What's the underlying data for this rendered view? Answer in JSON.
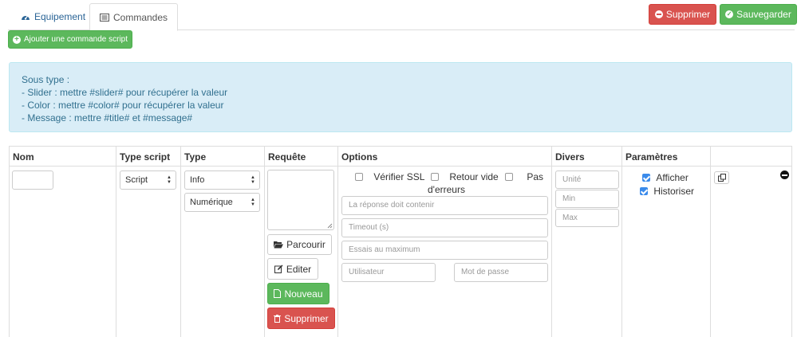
{
  "tabs": [
    {
      "label": "Equipement",
      "icon": "tachometer-icon"
    },
    {
      "label": "Commandes",
      "icon": "list-icon"
    }
  ],
  "header_buttons": {
    "delete_label": "Supprimer",
    "save_label": "Sauvegarder"
  },
  "add_command_label": "Ajouter une commande script",
  "info": {
    "lines": [
      "Sous type :",
      "- Slider : mettre #slider# pour récupérer la valeur",
      "- Color : mettre #color# pour récupérer la valeur",
      "- Message : mettre #title# et #message#"
    ]
  },
  "table": {
    "headers": [
      "Nom",
      "Type script",
      "Type",
      "Requête",
      "Options",
      "Divers",
      "Paramètres",
      ""
    ],
    "row": {
      "name_value": "",
      "script_type": "Script",
      "type": "Info",
      "subtype": "Numérique",
      "request_buttons": {
        "browse": "Parcourir",
        "edit": "Editer",
        "new": "Nouveau",
        "delete": "Supprimer"
      },
      "options": {
        "verify_ssl": "Vérifier SSL",
        "empty_return": "Retour vide",
        "no_errors_part1": "Pas",
        "no_errors_part2": "d'erreurs",
        "response_placeholder": "La réponse doit contenir",
        "timeout_placeholder": "Timeout (s)",
        "tries_placeholder": "Essais au maximum",
        "user_placeholder": "Utilisateur",
        "password_placeholder": "Mot de passe"
      },
      "divers": {
        "unit_placeholder": "Unité",
        "min_placeholder": "Min",
        "max_placeholder": "Max"
      },
      "params": {
        "display": "Afficher",
        "display_checked": true,
        "history": "Historiser",
        "history_checked": true
      }
    }
  },
  "colors": {
    "danger": "#d9534f",
    "success": "#5cb85c",
    "info_bg": "#d9edf7",
    "info_text": "#31708f",
    "link": "#2a6496"
  }
}
